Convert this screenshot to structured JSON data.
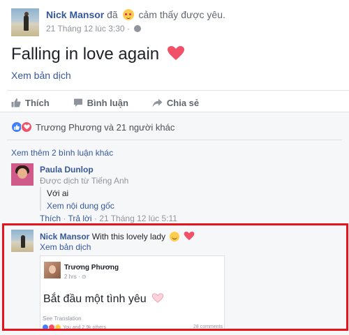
{
  "post": {
    "author": "Nick Mansor",
    "feeling_prefix": "đã",
    "feeling_text": "cảm thấy được yêu.",
    "timestamp": "21 Tháng 12 lúc 3:30 ·",
    "text": "Falling in love again",
    "see_translation": "Xem bản dịch"
  },
  "actions": {
    "like": "Thích",
    "comment": "Bình luận",
    "share": "Chia sẻ"
  },
  "reactions": {
    "summary": "Trương Phương và 21 người khác"
  },
  "comments": {
    "view_more": "Xem thêm 2 bình luận khác",
    "items": [
      {
        "author": "Paula Dunlop",
        "translated_label": "Được dịch từ Tiếng Anh",
        "text": "Với ai",
        "see_original": "Xem nội dung gốc",
        "like": "Thích",
        "reply": "Trả lời",
        "time": "21 Tháng 12 lúc 5:11",
        "sep": "·"
      },
      {
        "author": "Nick Mansor",
        "text": "With this lovely lady",
        "see_translation": "Xem bản dịch",
        "shared": {
          "author": "Trương Phương",
          "meta": "2 hrs · ⊙",
          "text": "Bắt đầu một tình yêu",
          "see_translation": "See Translation",
          "reactions": "You and 2.9k others",
          "comments": "28 comments"
        }
      }
    ]
  },
  "colors": {
    "link": "#365899",
    "highlight_border": "#e8121b",
    "heart": "#f25268",
    "like_blue": "#4080ff"
  },
  "icons": [
    "thumbs-up-icon",
    "comment-bubble-icon",
    "share-arrow-icon",
    "globe-icon",
    "heart-icon",
    "smile-emoji-icon",
    "feeling-loved-emoji-icon"
  ]
}
